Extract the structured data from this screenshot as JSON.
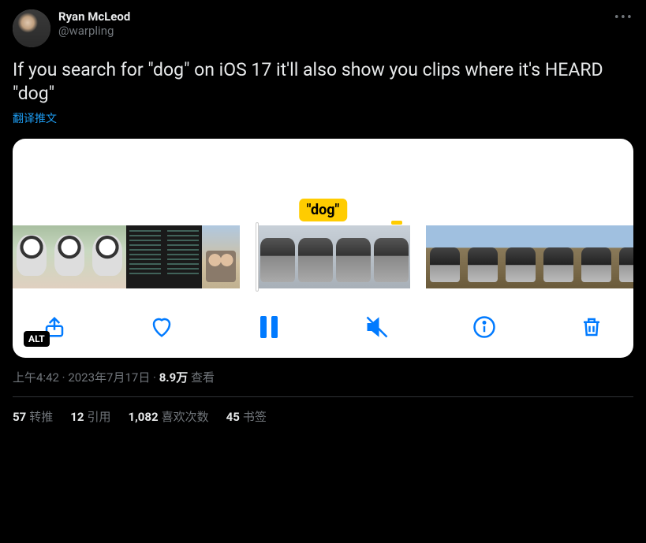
{
  "author": {
    "display_name": "Ryan McLeod",
    "handle": "@warpling"
  },
  "tweet_text": "If you search for \"dog\" on iOS 17 it'll also show you clips where it's HEARD \"dog\"",
  "translate_label": "翻译推文",
  "media": {
    "tag_text": "\"dog\"",
    "alt_badge": "ALT"
  },
  "meta": {
    "time": "上午4:42",
    "separator": " · ",
    "date": "2023年7月17日",
    "views_count": "8.9万",
    "views_label": " 查看"
  },
  "stats": {
    "retweets": {
      "count": "57",
      "label": "转推"
    },
    "quotes": {
      "count": "12",
      "label": "引用"
    },
    "likes": {
      "count": "1,082",
      "label": "喜欢次数"
    },
    "bookmarks": {
      "count": "45",
      "label": "书签"
    }
  }
}
